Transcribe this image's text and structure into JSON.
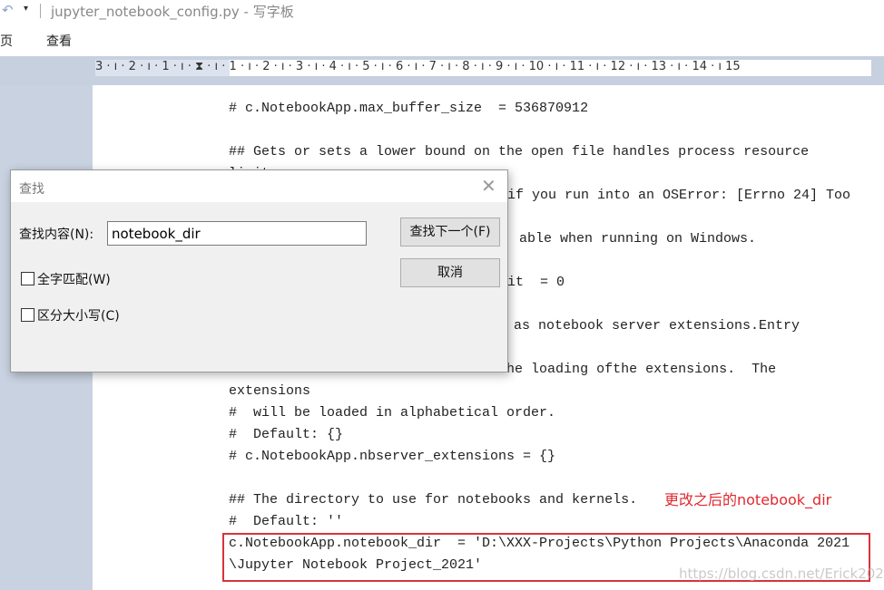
{
  "window": {
    "title": "jupyter_notebook_config.py - 写字板"
  },
  "menu": {
    "items": [
      "页",
      "查看"
    ]
  },
  "ruler": {
    "labels": "3 · ı · 2 · ı · 1 · ı · ⧗ · ı · 1 · ı · 2 · ı · 3 · ı · 4 · ı · 5 · ı · 6 · ı · 7 · ı · 8 · ı · 9 · ı · 10 · ı · 11 · ı · 12 · ı · 13 · ı · 14 · ı 15"
  },
  "document": {
    "lines": [
      "# c.NotebookApp.max_buffer_size  = 536870912",
      "## Gets or sets a lower bound on the open file handles process resource",
      "limit.",
      "if you run into an OSError: [Errno 24] Too",
      "able when running on Windows.",
      "it  = 0",
      "as notebook server extensions.Entry",
      "#  be used to enable and disable the loading ofthe extensions.  The",
      "extensions",
      "#  will be loaded in alphabetical order.",
      "#  Default: {}",
      "# c.NotebookApp.nbserver_extensions = {}",
      "## The directory to use for notebooks and kernels.",
      "#  Default: ''",
      "c.NotebookApp.notebook_dir  = 'D:\\XXX-Projects\\Python Projects\\Anaconda 2021",
      "\\Jupyter Notebook Project_2021'"
    ],
    "annotation": "更改之后的notebook_dir",
    "watermark": "https://blog.csdn.net/Erick2020",
    "highlight_color": "#d9323a"
  },
  "find_dialog": {
    "title": "查找",
    "find_label": "查找内容(N):",
    "find_value": "notebook_dir",
    "find_next": "查找下一个(F)",
    "cancel": "取消",
    "match_whole": "全字匹配(W)",
    "match_case": "区分大小写(C)"
  }
}
